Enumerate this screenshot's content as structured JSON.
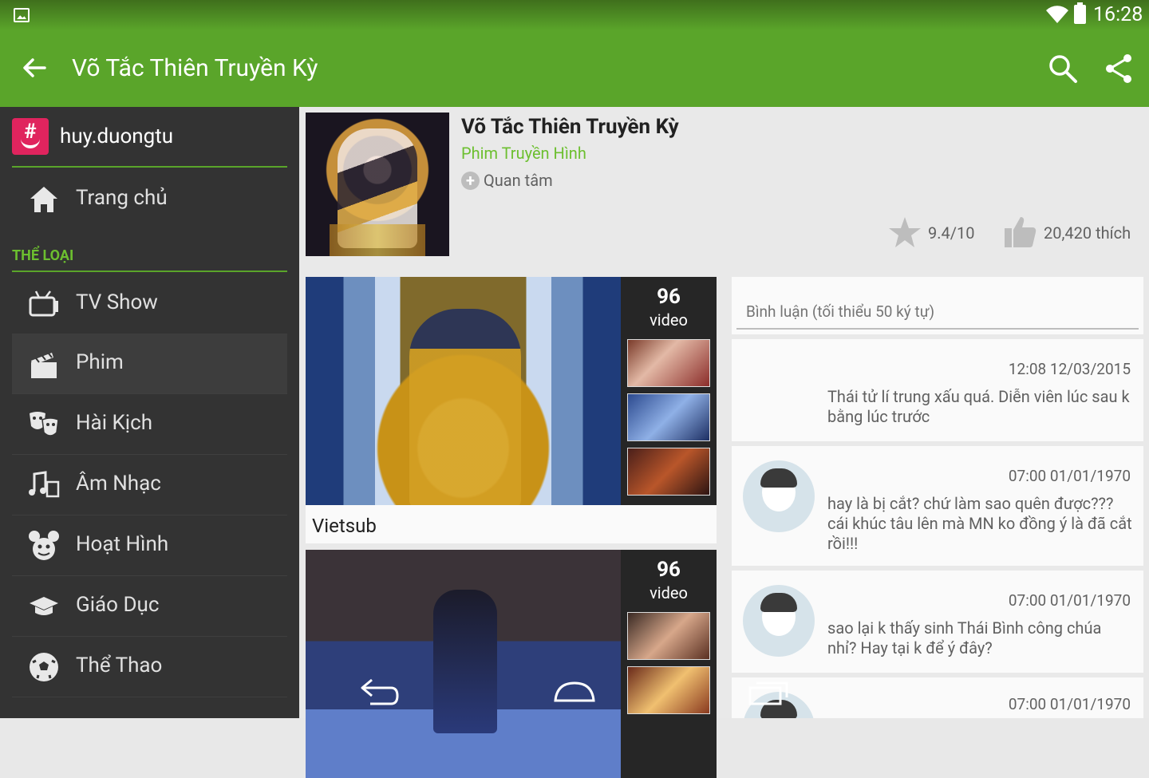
{
  "status_bar": {
    "time": "16:28",
    "icons": [
      "picture-icon",
      "wifi-icon",
      "battery-icon"
    ]
  },
  "app_bar": {
    "title": "Võ Tắc Thiên Truyền Kỳ",
    "icons": [
      "back-arrow-icon",
      "search-icon",
      "share-icon"
    ]
  },
  "drawer": {
    "username": "huy.duongtu",
    "home": {
      "label": "Trang chủ",
      "icon": "home-icon"
    },
    "section_header": "THỂ LOẠI",
    "items": [
      {
        "label": "TV Show",
        "icon": "tv-icon"
      },
      {
        "label": "Phim",
        "icon": "clapperboard-icon",
        "active": true
      },
      {
        "label": "Hài Kịch",
        "icon": "theater-masks-icon"
      },
      {
        "label": "Âm Nhạc",
        "icon": "music-icon"
      },
      {
        "label": "Hoạt Hình",
        "icon": "mouse-cartoon-icon"
      },
      {
        "label": "Giáo Dục",
        "icon": "graduation-cap-icon"
      },
      {
        "label": "Thể Thao",
        "icon": "soccer-ball-icon"
      }
    ]
  },
  "show": {
    "title": "Võ Tắc Thiên Truyền Kỳ",
    "genre": "Phim Truyền Hình",
    "follow_label": "Quan tâm",
    "rating": "9.4/10",
    "likes": "20,420 thích"
  },
  "videos": [
    {
      "count": "96",
      "unit": "video",
      "title": "Vietsub"
    },
    {
      "count": "96",
      "unit": "video",
      "title": ""
    }
  ],
  "comment_input": {
    "placeholder": "Bình luận (tối thiểu 50 ký tự)"
  },
  "comments": [
    {
      "time": "12:08 12/03/2015",
      "text": "Thái tử lí trung xấu quá. Diễn viên lúc sau k bằng lúc trước",
      "has_avatar": false
    },
    {
      "time": "07:00 01/01/1970",
      "text": "hay là bị cắt? chứ làm sao quên được??? cái khúc tâu lên mà MN ko đồng ý là đã cắt rồi!!!",
      "has_avatar": true
    },
    {
      "time": "07:00 01/01/1970",
      "text": "sao lại k thấy sinh Thái Bình công chúa nhỉ? Hay tại k để ý đây?",
      "has_avatar": true
    },
    {
      "time": "07:00 01/01/1970",
      "text": "",
      "has_avatar": true
    }
  ],
  "colors": {
    "primary": "#5aa52a",
    "accent_text": "#6cbf2f",
    "drawer_bg": "#333333",
    "logo": "#e0245e"
  }
}
